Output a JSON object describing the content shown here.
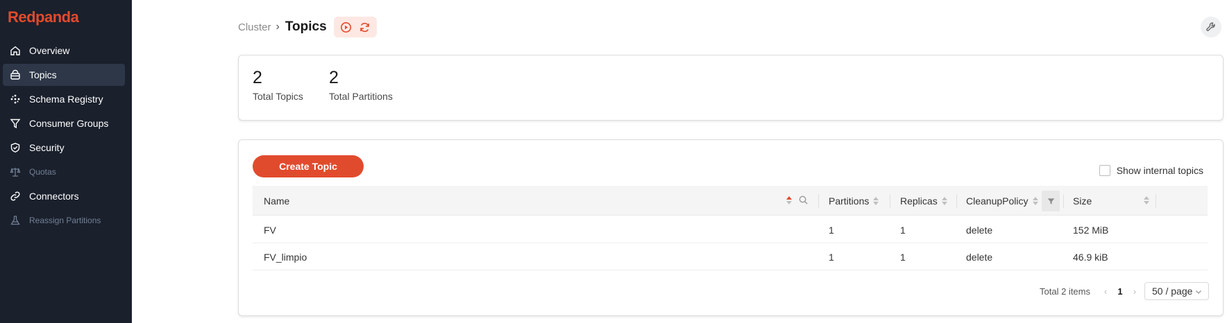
{
  "app": {
    "brand": "Redpanda",
    "accent": "#e14b2d"
  },
  "sidebar": {
    "items": [
      {
        "label": "Overview",
        "icon": "home-icon",
        "active": false,
        "disabled": false
      },
      {
        "label": "Topics",
        "icon": "topics-icon",
        "active": true,
        "disabled": false
      },
      {
        "label": "Schema Registry",
        "icon": "schema-icon",
        "active": false,
        "disabled": false
      },
      {
        "label": "Consumer Groups",
        "icon": "funnel-icon",
        "active": false,
        "disabled": false
      },
      {
        "label": "Security",
        "icon": "shield-icon",
        "active": false,
        "disabled": false
      },
      {
        "label": "Quotas",
        "icon": "scale-icon",
        "active": false,
        "disabled": true
      },
      {
        "label": "Connectors",
        "icon": "link-icon",
        "active": false,
        "disabled": false
      },
      {
        "label": "Reassign Partitions",
        "icon": "flask-icon",
        "active": false,
        "disabled": true
      }
    ]
  },
  "header": {
    "breadcrumb_parent": "Cluster",
    "title": "Topics"
  },
  "stats": [
    {
      "value": "2",
      "label": "Total Topics"
    },
    {
      "value": "2",
      "label": "Total Partitions"
    }
  ],
  "toolbar": {
    "create_label": "Create Topic",
    "show_internal_label": "Show internal topics",
    "show_internal_checked": false
  },
  "table": {
    "columns": [
      "Name",
      "Partitions",
      "Replicas",
      "CleanupPolicy",
      "Size"
    ],
    "rows": [
      {
        "name": "FV",
        "partitions": "1",
        "replicas": "1",
        "cleanup": "delete",
        "size": "152 MiB"
      },
      {
        "name": "FV_limpio",
        "partitions": "1",
        "replicas": "1",
        "cleanup": "delete",
        "size": "46.9 kiB"
      }
    ]
  },
  "pagination": {
    "total": "Total 2 items",
    "current_page": "1",
    "page_size": "50 / page"
  }
}
